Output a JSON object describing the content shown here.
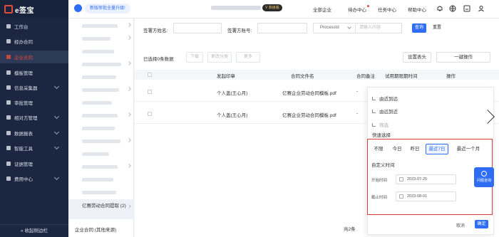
{
  "brand": {
    "name": "e签宝"
  },
  "topbar": {
    "notice": "新版审批全量升级!",
    "vip_badge": "V 高级版",
    "nav": [
      "全部企业",
      "待办中心",
      "任务中心",
      "帮助中心"
    ]
  },
  "sidebar": {
    "items": [
      {
        "label": "工作台",
        "chevron": false
      },
      {
        "label": "经办合同",
        "chevron": false
      },
      {
        "label": "企业合同",
        "chevron": false,
        "active": true
      },
      {
        "label": "模板管理",
        "chevron": false
      },
      {
        "label": "信息采集器",
        "chevron": true
      },
      {
        "label": "审批管理",
        "chevron": false
      },
      {
        "label": "相对方管理",
        "chevron": true
      },
      {
        "label": "数据报表",
        "chevron": true
      },
      {
        "label": "智能工具",
        "chevron": true
      },
      {
        "label": "证据管理",
        "chevron": false
      },
      {
        "label": "费用中心",
        "chevron": true
      }
    ],
    "collapse_label": "« 收起侧边栏"
  },
  "subpanel": {
    "active_item": "亿赛劳动合同提取 (2)",
    "bottom_item": "企业合同 (其他来源)"
  },
  "filters": {
    "signer_name_label": "签署方姓名:",
    "signer_account_label": "签署方账号:",
    "select_value": "ProcessId",
    "content_placeholder": "请输入内容",
    "search_label": "查询",
    "reset_label": "重置"
  },
  "toolbar": {
    "selected_text": "已选择0条数据",
    "download": "下载",
    "change_category": "更改分类",
    "more": "更多",
    "set_header": "设置表头",
    "batch_ops": "一键操作"
  },
  "table": {
    "columns": [
      "",
      "发起印章",
      "合同文件名",
      "合同备注",
      "试用期限期时间",
      "操作"
    ],
    "rows": [
      {
        "seal": "个人盖(王心月)",
        "file": "亿赛企业劳动合同模板.pdf",
        "note": "-"
      },
      {
        "seal": "个人盖(王心月)",
        "file": "亿赛企业劳动合同模板.pdf",
        "note": "-"
      }
    ]
  },
  "popover": {
    "sort_asc": "由近到远",
    "sort_desc": "由远到近",
    "filter": "筛选",
    "quick_select": "快速选择",
    "chips": [
      "不限",
      "今日",
      "昨日",
      "最近7日",
      "最近一个月"
    ],
    "active_chip": "最近7日",
    "custom_time": "自定义时间",
    "start_label": "开始时间",
    "start_value": "2023-07-25",
    "end_label": "截止时间",
    "end_value": "2023-08-01",
    "cancel": "取消",
    "confirm": "确定"
  },
  "help_label": "问题咨询",
  "pager": {
    "total": "共2条"
  }
}
